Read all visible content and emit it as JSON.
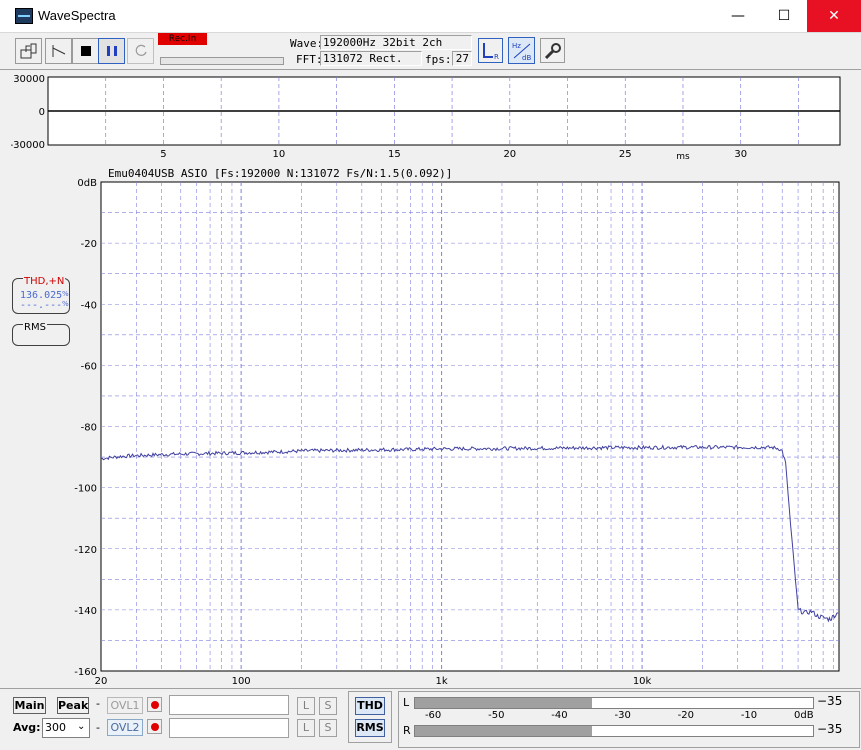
{
  "window": {
    "title": "WaveSpectra",
    "minimize": "—",
    "maximize": "☐",
    "close": "✕"
  },
  "toolbar": {
    "rec_in": "Rec.In",
    "wave_label": "Wave:",
    "wave_value": "192000Hz 32bit 2ch",
    "fft_label": "FFT:",
    "fft_value": "131072 Rect.",
    "fps_label": "fps:",
    "fps_value": "27",
    "icons": [
      "open-icon",
      "waveform-icon",
      "stop-icon",
      "pause-icon",
      "refresh-icon",
      "lr-icon",
      "hz-db-icon",
      "settings-wrench-icon"
    ]
  },
  "wave": {
    "y_ticks": [
      "30000",
      "0",
      "-30000"
    ],
    "x_ticks": [
      "5",
      "10",
      "15",
      "20",
      "25",
      "30"
    ],
    "x_unit": "ms"
  },
  "spectrum": {
    "header": "Emu0404USB ASIO   [Fs:192000 N:131072 Fs/N:1.5(0.092)]",
    "y_ticks": [
      "0dB",
      "-20",
      "-40",
      "-60",
      "-80",
      "-100",
      "-120",
      "-140",
      "-160"
    ],
    "x_ticks": [
      "20",
      "100",
      "1k",
      "10k"
    ]
  },
  "thd": {
    "title": "THD,+N",
    "value1": "136.025",
    "value2": "---.---",
    "unit": "%"
  },
  "rms": {
    "title": "RMS"
  },
  "bottom": {
    "main": "Main",
    "peak": "Peak",
    "dash": "-",
    "ovl1": "OVL1",
    "ovl2": "OVL2",
    "avg_label": "Avg:",
    "avg_value": "300",
    "l": "L",
    "s": "S",
    "thd": "THD",
    "rms": "RMS",
    "meter_l": "L",
    "meter_r": "R",
    "meter_scale": [
      "-60",
      "-50",
      "-40",
      "-30",
      "-20",
      "-10",
      "0dB"
    ],
    "meter_l_value": "−35",
    "meter_r_value": "−35",
    "meter_l_level": -35,
    "meter_r_level": -35
  },
  "colors": {
    "trace": "#4040a0",
    "grid": "#8080e0",
    "rec": "#e00000",
    "thd_title": "#d00000",
    "thd_value": "#4a6ad0"
  },
  "chart_data": {
    "type": "line",
    "series": [
      {
        "x": [
          20,
          25,
          30,
          40,
          50,
          70,
          100,
          150,
          200,
          300,
          500,
          700,
          1000,
          2000,
          3000,
          5000,
          7000,
          10000,
          15000,
          20000,
          30000,
          40000,
          45000,
          48000,
          50000,
          52000,
          55000,
          60000,
          65000,
          70000,
          75000,
          80000,
          85000,
          88000,
          90000,
          95000
        ],
        "y": [
          -90.5,
          -89.8,
          -89.5,
          -89.2,
          -89,
          -88.8,
          -88.6,
          -88.3,
          -88,
          -87.8,
          -87.6,
          -87.5,
          -87.3,
          -87.2,
          -87.1,
          -87,
          -86.9,
          -86.9,
          -86.8,
          -86.8,
          -86.8,
          -86.8,
          -86.9,
          -87.2,
          -88,
          -92,
          -112,
          -140,
          -141,
          -140.5,
          -142,
          -142.5,
          -143,
          -142.8,
          -142,
          -141
        ]
      }
    ],
    "xscale": "log",
    "xlim": [
      20,
      96000
    ],
    "ylim": [
      -160,
      0
    ],
    "grid": true
  }
}
